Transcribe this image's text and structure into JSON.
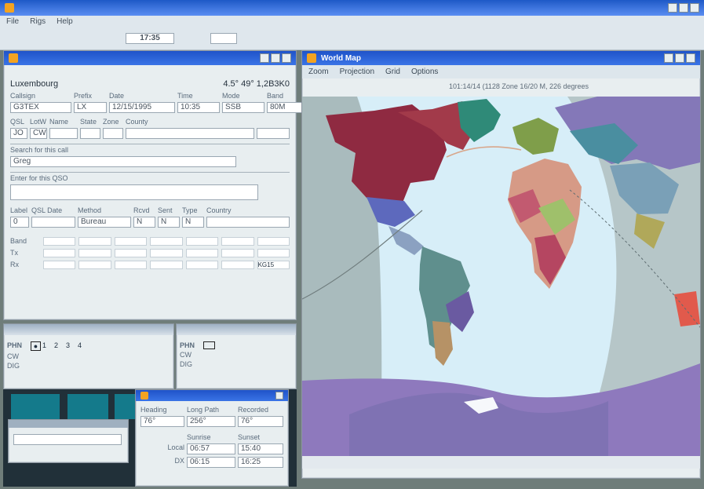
{
  "outer": {
    "title": "",
    "menu": [
      "File",
      "Rigs",
      "Help"
    ],
    "time": "17:35",
    "tools": [
      "…"
    ]
  },
  "qso_window": {
    "title": "",
    "menu": [],
    "location": "Luxembourg",
    "coords": "4.5° 49° 1,2B3K0",
    "headers": [
      "Callsign",
      "Prefix",
      "Date",
      "Time",
      "Mode",
      "Band"
    ],
    "values": [
      "G3TEX",
      "LX",
      "12/15/1995",
      "10:35",
      "SSB",
      "80M"
    ],
    "row2_headers": [
      "QSL",
      "LotW",
      "Name",
      "State",
      "Zone",
      "County"
    ],
    "row2_values": [
      "JO",
      "CW",
      "",
      "",
      "",
      ""
    ],
    "call_label": "Search for this call",
    "call_value": "Greg",
    "second_label": "Enter for this QSO",
    "sec_labels": [
      "Label",
      "QSL Date",
      "Method",
      "Rcvd",
      "Sent",
      "Type",
      "Country"
    ],
    "sec_values": [
      "0",
      "",
      "Bureau",
      "N",
      "N",
      "N",
      ""
    ],
    "table_cols": [
      "",
      "",
      "",
      "",
      "",
      "",
      ""
    ],
    "table_rows": [
      "Band",
      "Tx",
      "Rx"
    ],
    "footer_labels": [
      "",
      "",
      "",
      "",
      "",
      "",
      ""
    ],
    "footer_value": "KG15"
  },
  "bands_left": {
    "rows": [
      "PHN",
      "CW",
      "DIG"
    ],
    "marks": [
      "●",
      "1",
      "2",
      "3",
      "4"
    ]
  },
  "bands_right": {
    "rows": [
      "PHN",
      "CW",
      "DIG"
    ]
  },
  "map_window": {
    "title": "World Map",
    "menu": [
      "Zoom",
      "Projection",
      "Grid",
      "Options"
    ],
    "status": "101:14/14 (1128 Zone 16/20 M, 226 degrees"
  },
  "dialog": {
    "title": "",
    "headers": [
      "Heading",
      "Long Path",
      "Recorded"
    ],
    "values": [
      "76°",
      "256°",
      "76°"
    ],
    "label_local": "Local",
    "label_dx": "DX",
    "mid_headers": [
      "Sunrise",
      "Sunset"
    ],
    "local": [
      "06:57",
      "15:40"
    ],
    "dx": [
      "06:15",
      "16:25"
    ]
  },
  "taskbar": {
    "buttons": [
      "",
      "",
      ""
    ],
    "mini_label": "",
    "mini_value": "",
    "mini_row": ""
  }
}
